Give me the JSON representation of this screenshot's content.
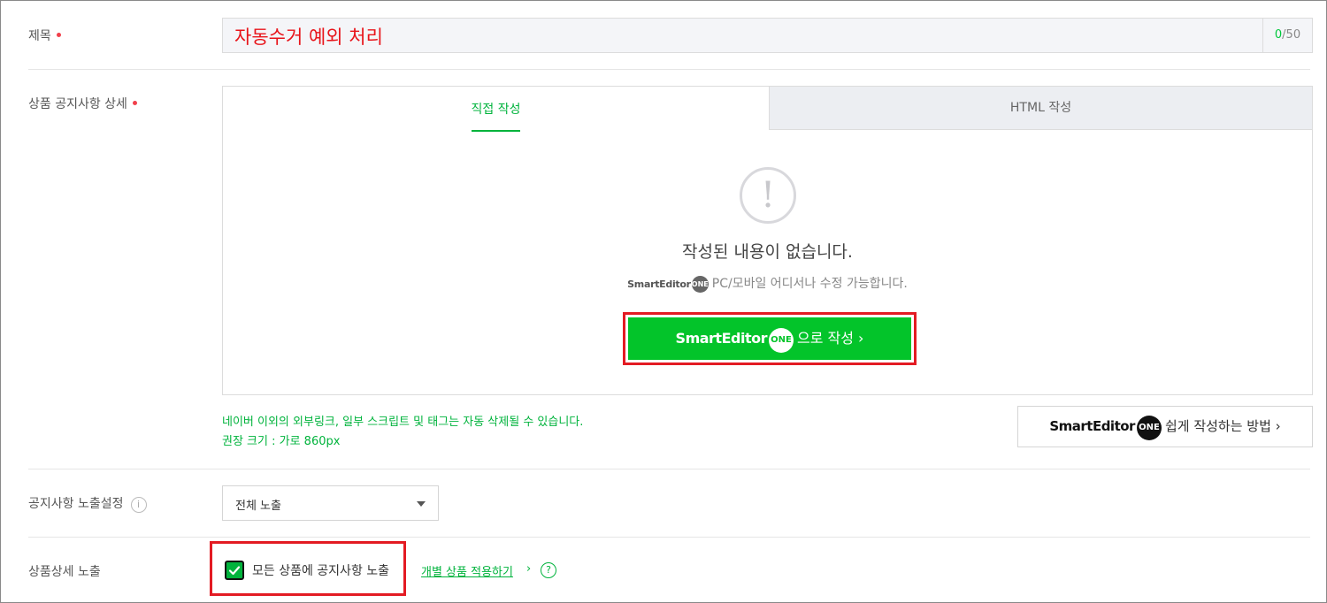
{
  "title_row": {
    "label": "제목",
    "value": "자동수거 예외 처리",
    "count_current": "0",
    "count_max": "/50"
  },
  "notice_row": {
    "label": "상품 공지사항 상세",
    "tabs": [
      {
        "label": "직접 작성",
        "active": true
      },
      {
        "label": "HTML 작성",
        "active": false
      }
    ],
    "empty_message": "작성된 내용이 없습니다.",
    "smart_editor_brand": "SmartEditor",
    "one_badge": "ONE",
    "smart_editor_desc": "PC/모바일 어디서나 수정 가능합니다.",
    "write_button": {
      "brand": "SmartEditor",
      "badge": "ONE",
      "suffix": "으로 작성",
      "chevron": "›"
    },
    "notice_line1": "네이버 이외의 외부링크, 일부 스크립트 및 태그는 자동 삭제될 수 있습니다.",
    "notice_line2": "권장 크기 : 가로 860px",
    "howto_button": {
      "brand": "SmartEditor",
      "badge": "ONE",
      "suffix": "쉽게 작성하는 방법",
      "chevron": "›"
    }
  },
  "exposure_setting": {
    "label": "공지사항 노출설정",
    "info_icon": "i",
    "selected": "전체 노출"
  },
  "detail_exposure": {
    "label": "상품상세 노출",
    "checkbox_checked": true,
    "checkbox_label": "모든 상품에 공지사항 노출",
    "link_label": "개별 상품 적용하기",
    "link_chevron": "›",
    "help_icon": "?"
  },
  "colors": {
    "accent_green": "#00b33c",
    "button_green": "#03c42a",
    "required_dot": "#f1404b",
    "highlight_red": "#e31b23",
    "title_text": "#e8141a"
  }
}
